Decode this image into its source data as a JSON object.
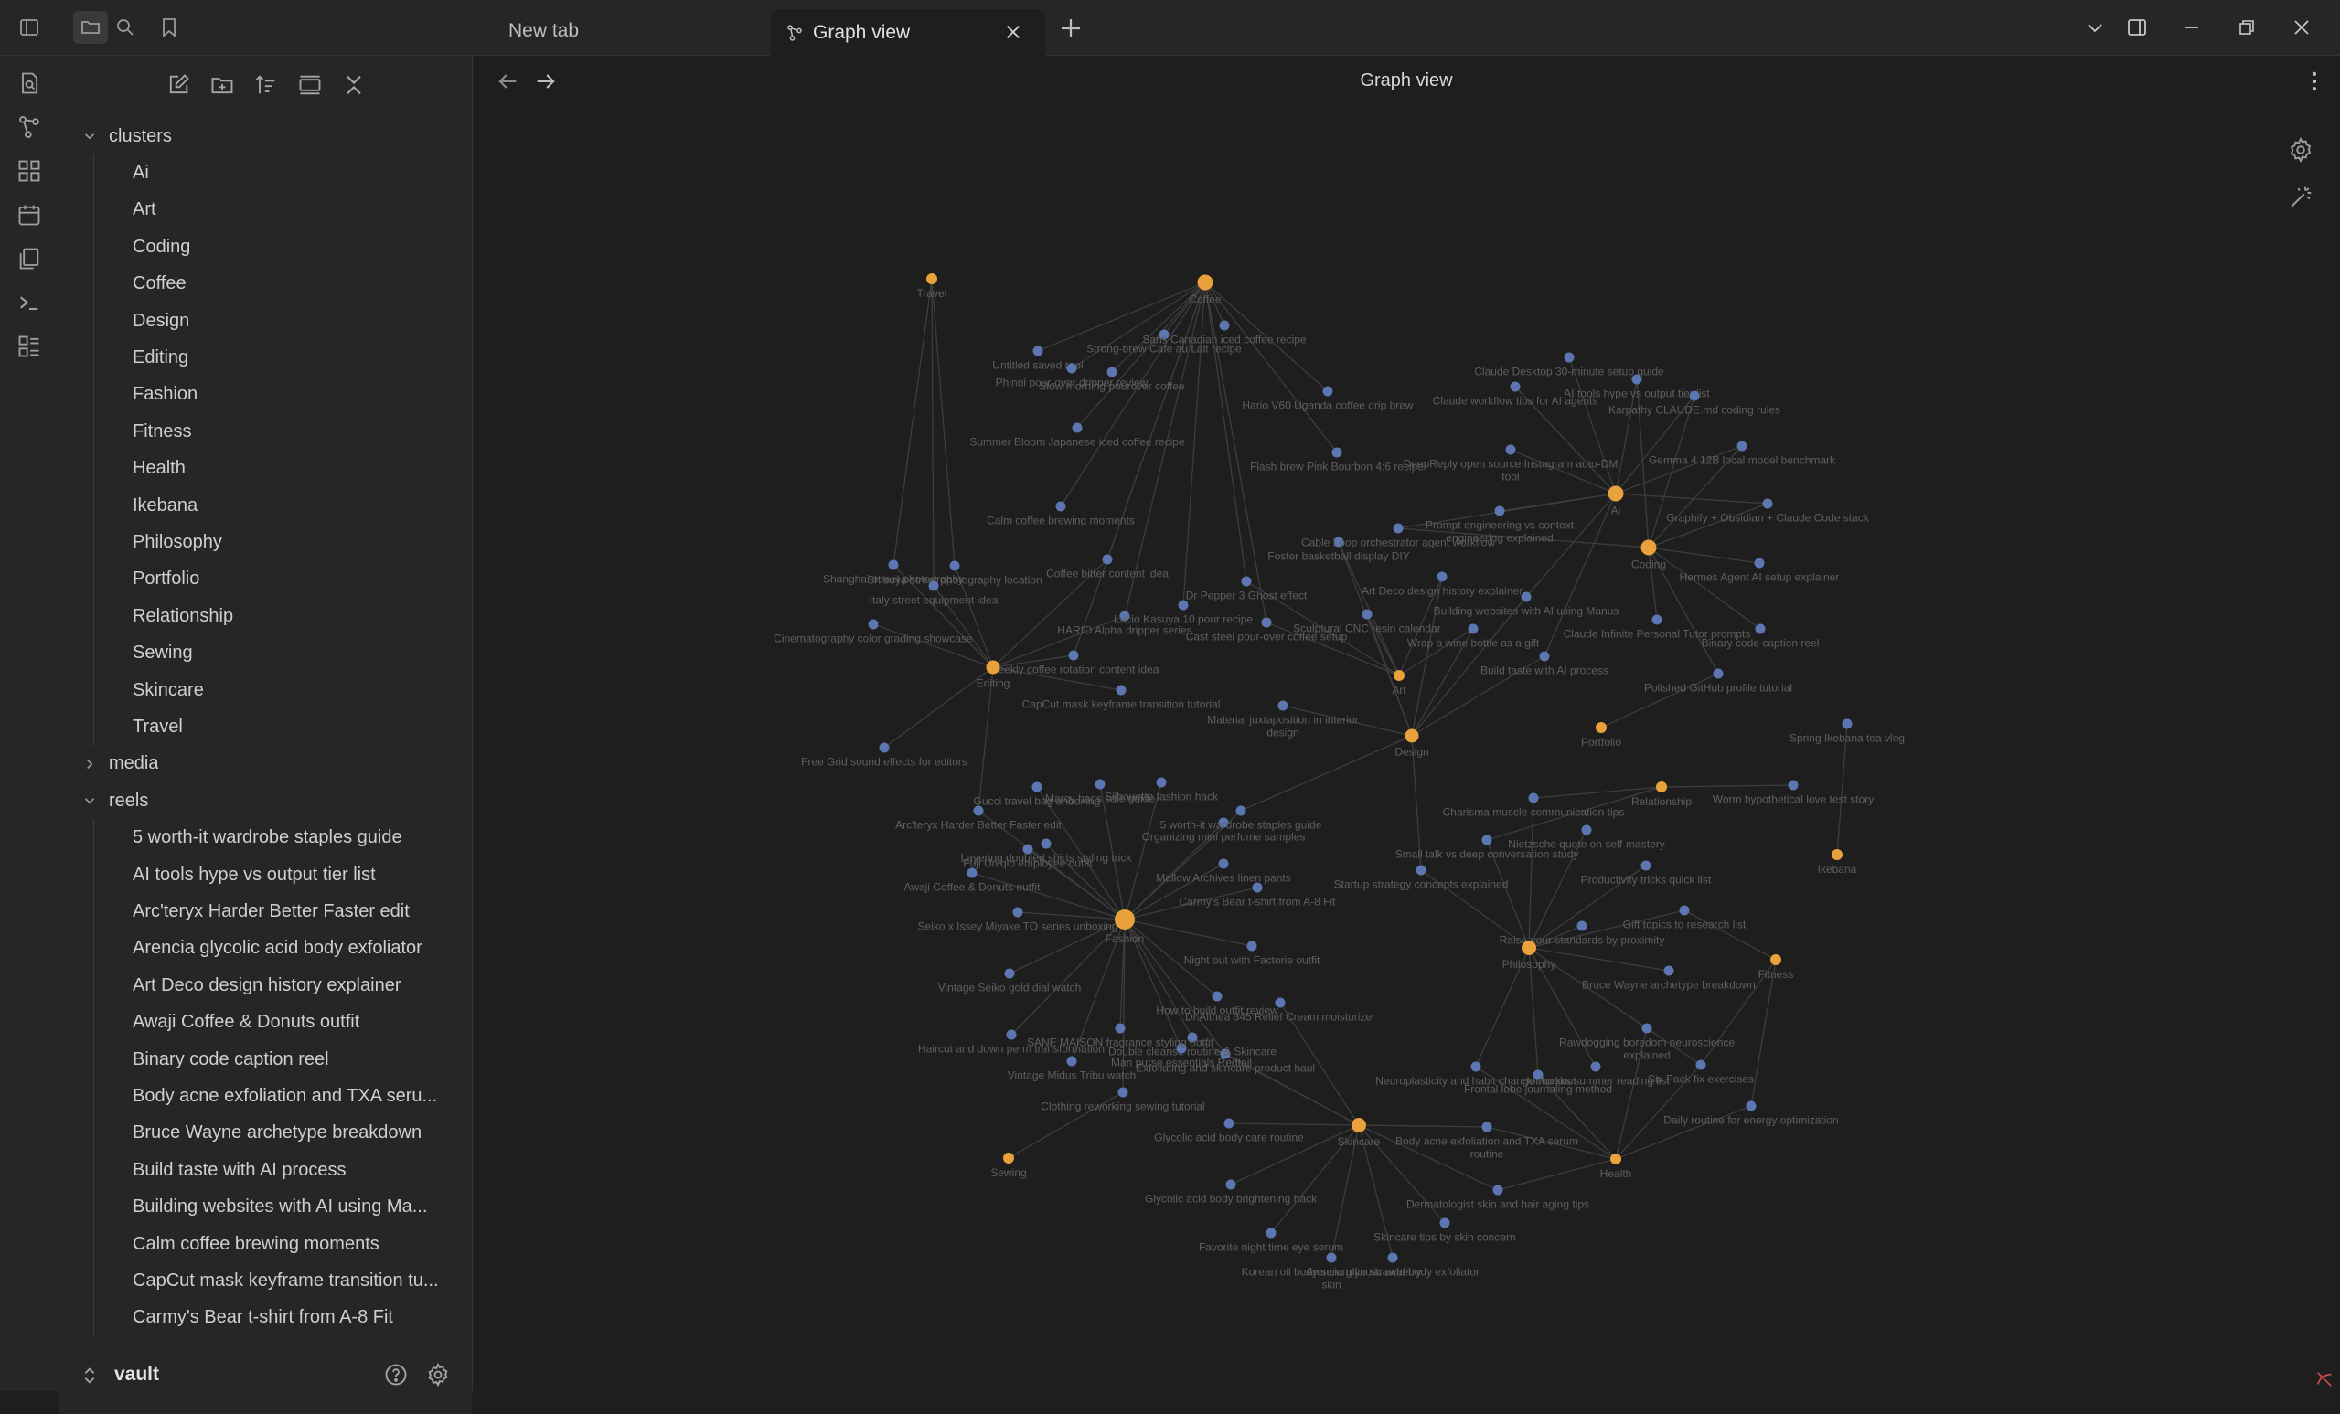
{
  "tabs": [
    {
      "label": "New tab",
      "active": false
    },
    {
      "label": "Graph view",
      "active": true
    }
  ],
  "view": {
    "title": "Graph view"
  },
  "sidebar": {
    "tree": [
      {
        "label": "clusters",
        "type": "folder",
        "expanded": true,
        "children": [
          "Ai",
          "Art",
          "Coding",
          "Coffee",
          "Design",
          "Editing",
          "Fashion",
          "Fitness",
          "Health",
          "Ikebana",
          "Philosophy",
          "Portfolio",
          "Relationship",
          "Sewing",
          "Skincare",
          "Travel"
        ]
      },
      {
        "label": "media",
        "type": "folder",
        "expanded": false,
        "children": []
      },
      {
        "label": "reels",
        "type": "folder",
        "expanded": true,
        "children": [
          "5 worth-it wardrobe staples guide",
          "AI tools hype vs output tier list",
          "Arc'teryx Harder Better Faster edit",
          "Arencia glycolic acid body exfoliator",
          "Art Deco design history explainer",
          "Awaji Coffee & Donuts outfit",
          "Binary code caption reel",
          "Body acne exfoliation and TXA seru...",
          "Bruce Wayne archetype breakdown",
          "Build taste with AI process",
          "Building websites with AI using Ma...",
          "Calm coffee brewing moments",
          "CapCut mask keyframe transition tu...",
          "Carmy's Bear t-shirt from A-8 Fit"
        ]
      }
    ],
    "vault_name": "vault"
  },
  "colors": {
    "hub": "#e9a23b",
    "note": "#5b76b0",
    "edge": "#3d3d3d",
    "label": "#5f5f5f",
    "accent": "#d14b4b"
  },
  "graph": {
    "hubs": [
      {
        "id": "Coffee",
        "label": "Coffee"
      },
      {
        "id": "Travel",
        "label": "Travel"
      },
      {
        "id": "Editing",
        "label": "Editing"
      },
      {
        "id": "Ai",
        "label": "Ai"
      },
      {
        "id": "Coding",
        "label": "Coding"
      },
      {
        "id": "Art",
        "label": "Art"
      },
      {
        "id": "Design",
        "label": "Design"
      },
      {
        "id": "Portfolio",
        "label": "Portfolio"
      },
      {
        "id": "Fashion",
        "label": "Fashion"
      },
      {
        "id": "Philosophy",
        "label": "Philosophy"
      },
      {
        "id": "Relationship",
        "label": "Relationship"
      },
      {
        "id": "Ikebana",
        "label": "Ikebana"
      },
      {
        "id": "Fitness",
        "label": "Fitness"
      },
      {
        "id": "Sewing",
        "label": "Sewing"
      },
      {
        "id": "Skincare",
        "label": "Skincare"
      },
      {
        "id": "Health",
        "label": "Health"
      }
    ],
    "notes": [
      {
        "label": "Untitled saved reel",
        "links": [
          "Coffee"
        ]
      },
      {
        "label": "Phinoi pour-over dripper review",
        "links": [
          "Coffee"
        ]
      },
      {
        "label": "Strong-brew Cafe au Lait recipe",
        "links": [
          "Coffee"
        ]
      },
      {
        "label": "Sans Canadian iced coffee recipe",
        "links": [
          "Coffee"
        ]
      },
      {
        "label": "Slow morning pourover coffee",
        "links": [
          "Coffee"
        ]
      },
      {
        "label": "Hario V60 Uganda coffee drip brew",
        "links": [
          "Coffee"
        ]
      },
      {
        "label": "Summer Bloom Japanese iced coffee recipe",
        "links": [
          "Coffee"
        ]
      },
      {
        "label": "Flash brew Pink Bourbon 4:6 recipe",
        "links": [
          "Coffee"
        ]
      },
      {
        "label": "Calm coffee brewing moments",
        "links": [
          "Coffee"
        ]
      },
      {
        "label": "Coffee bitter content idea",
        "links": [
          "Coffee",
          "Editing"
        ]
      },
      {
        "label": "Shibuya street photography location",
        "links": [
          "Travel",
          "Editing"
        ]
      },
      {
        "label": "Shanghai street photography",
        "links": [
          "Travel",
          "Editing"
        ]
      },
      {
        "label": "Italy street equipment idea",
        "links": [
          "Travel",
          "Editing"
        ]
      },
      {
        "label": "Cinematography color grading showcase",
        "links": [
          "Editing"
        ]
      },
      {
        "label": "HARIO Alpha dripper series",
        "links": [
          "Coffee",
          "Editing"
        ]
      },
      {
        "label": "Weekly coffee rotation content idea",
        "links": [
          "Coffee",
          "Editing"
        ]
      },
      {
        "label": "Lucio Kasuya 10 pour recipe",
        "links": [
          "Coffee"
        ]
      },
      {
        "label": "Cast steel pour-over coffee setup",
        "links": [
          "Coffee",
          "Art"
        ]
      },
      {
        "label": "Dr Pepper 3 Ghost effect",
        "links": [
          "Coffee",
          "Art"
        ]
      },
      {
        "label": "Free Grid sound effects for editors",
        "links": [
          "Editing"
        ]
      },
      {
        "label": "CapCut mask keyframe transition tutorial",
        "links": [
          "Editing"
        ]
      },
      {
        "label": "Material juxtaposition in interior design",
        "links": [
          "Design"
        ]
      },
      {
        "label": "Sculptural CNC resin calendar",
        "links": [
          "Art",
          "Design"
        ]
      },
      {
        "label": "Foster basketball display DIY",
        "links": [
          "Art",
          "Design"
        ]
      },
      {
        "label": "Art Deco design history explainer",
        "links": [
          "Art",
          "Design"
        ]
      },
      {
        "label": "Building websites with AI using Manus",
        "links": [
          "Design",
          "Ai"
        ]
      },
      {
        "label": "Wrap a wine bottle as a gift",
        "links": [
          "Art",
          "Design"
        ]
      },
      {
        "label": "Build taste with AI process",
        "links": [
          "Design",
          "Ai"
        ]
      },
      {
        "label": "Cable Loop orchestrator agent workflow",
        "links": [
          "Ai",
          "Coding"
        ]
      },
      {
        "label": "Claude Desktop 30-minute setup guide",
        "links": [
          "Ai"
        ]
      },
      {
        "label": "Claude workflow tips for AI agents",
        "links": [
          "Ai"
        ]
      },
      {
        "label": "AI tools hype vs output tier list",
        "links": [
          "Ai",
          "Coding"
        ]
      },
      {
        "label": "Karpathy CLAUDE.md coding rules",
        "links": [
          "Ai",
          "Coding"
        ]
      },
      {
        "label": "DeepReply open source Instagram auto-DM tool",
        "links": [
          "Ai"
        ]
      },
      {
        "label": "Gemma 4 12B local model benchmark",
        "links": [
          "Ai",
          "Coding"
        ]
      },
      {
        "label": "Prompt engineering vs context engineering explained",
        "links": [
          "Ai"
        ]
      },
      {
        "label": "Graphify + Obsidian + Claude Code stack",
        "links": [
          "Ai",
          "Coding"
        ]
      },
      {
        "label": "Hermes Agent AI setup explainer",
        "links": [
          "Coding"
        ]
      },
      {
        "label": "Claude Infinite Personal Tutor prompts",
        "links": [
          "Coding"
        ]
      },
      {
        "label": "Binary code caption reel",
        "links": [
          "Coding"
        ]
      },
      {
        "label": "Polished GitHub profile tutorial",
        "links": [
          "Coding",
          "Portfolio"
        ]
      },
      {
        "label": "Spring Ikebana tea vlog",
        "links": [
          "Ikebana"
        ]
      },
      {
        "label": "Worm hypothetical love test story",
        "links": [
          "Relationship"
        ]
      },
      {
        "label": "Charisma muscle communication tips",
        "links": [
          "Philosophy",
          "Relationship"
        ]
      },
      {
        "label": "Nietzsche quote on self-mastery",
        "links": [
          "Philosophy"
        ]
      },
      {
        "label": "Small talk vs deep conversation study",
        "links": [
          "Philosophy",
          "Relationship"
        ]
      },
      {
        "label": "Productivity tricks quick list",
        "links": [
          "Philosophy"
        ]
      },
      {
        "label": "Startup strategy concepts explained",
        "links": [
          "Philosophy",
          "Design"
        ]
      },
      {
        "label": "Raise your standards by proximity",
        "links": [
          "Philosophy"
        ]
      },
      {
        "label": "Gift topics to research list",
        "links": [
          "Philosophy",
          "Fitness"
        ]
      },
      {
        "label": "Bruce Wayne archetype breakdown",
        "links": [
          "Philosophy"
        ]
      },
      {
        "label": "Rawdogging boredom neuroscience explained",
        "links": [
          "Philosophy",
          "Health"
        ]
      },
      {
        "label": "Six Pack fix exercises",
        "links": [
          "Philosophy",
          "Fitness",
          "Health"
        ]
      },
      {
        "label": "Hot books summer reading list",
        "links": [
          "Philosophy"
        ]
      },
      {
        "label": "Neuroplasticity and habit change workout",
        "links": [
          "Philosophy",
          "Health"
        ]
      },
      {
        "label": "Frontal lobe journaling method",
        "links": [
          "Philosophy",
          "Health"
        ]
      },
      {
        "label": "Daily routine for energy optimization",
        "links": [
          "Health",
          "Fitness"
        ]
      },
      {
        "label": "Body acne exfoliation and TXA serum routine",
        "links": [
          "Skincare",
          "Health"
        ]
      },
      {
        "label": "Dermatologist skin and hair aging tips",
        "links": [
          "Skincare",
          "Health"
        ]
      },
      {
        "label": "Skincare tips by skin concern",
        "links": [
          "Skincare"
        ]
      },
      {
        "label": "Arencia glycolic acid body exfoliator",
        "links": [
          "Skincare"
        ]
      },
      {
        "label": "Korean oil body serum for strawberry skin",
        "links": [
          "Skincare"
        ]
      },
      {
        "label": "Favorite night time eye serum",
        "links": [
          "Skincare"
        ]
      },
      {
        "label": "Glycolic acid body brightening hack",
        "links": [
          "Skincare"
        ]
      },
      {
        "label": "Glycolic acid body care routine",
        "links": [
          "Skincare"
        ]
      },
      {
        "label": "Dr.Althea 345 Relief Cream moisturizer",
        "links": [
          "Skincare"
        ]
      },
      {
        "label": "Exfoliating and skincare product haul",
        "links": [
          "Skincare",
          "Fashion"
        ]
      },
      {
        "label": "Double cleanse routine & Skincare",
        "links": [
          "Skincare",
          "Fashion"
        ]
      },
      {
        "label": "Clothing reworking sewing tutorial",
        "links": [
          "Fashion",
          "Sewing"
        ]
      },
      {
        "label": "Man purse essentials Redtail",
        "links": [
          "Fashion"
        ]
      },
      {
        "label": "SANE MAISON fragrance styling outfit",
        "links": [
          "Fashion"
        ]
      },
      {
        "label": "How to build outfit review",
        "links": [
          "Fashion"
        ]
      },
      {
        "label": "Night out with Factorie outfit",
        "links": [
          "Fashion"
        ]
      },
      {
        "label": "Vintage Midus Tribu watch",
        "links": [
          "Fashion"
        ]
      },
      {
        "label": "Haircut and down perm transformation",
        "links": [
          "Fashion"
        ]
      },
      {
        "label": "Vintage Seiko gold dial watch",
        "links": [
          "Fashion"
        ]
      },
      {
        "label": "Seiko x Issey Miyake TO series unboxing",
        "links": [
          "Fashion"
        ]
      },
      {
        "label": "Layering doubled shirts styling trick",
        "links": [
          "Fashion"
        ]
      },
      {
        "label": "Carmy's Bear t-shirt from A-8 Fit",
        "links": [
          "Fashion"
        ]
      },
      {
        "label": "Mallow Archives linen pants",
        "links": [
          "Fashion"
        ]
      },
      {
        "label": "Organizing mini perfume samples",
        "links": [
          "Fashion"
        ]
      },
      {
        "label": "Awaji Coffee & Donuts outfit",
        "links": [
          "Fashion"
        ]
      },
      {
        "label": "Fuji Uniqlo employee outfit",
        "links": [
          "Fashion"
        ]
      },
      {
        "label": "Arc'teryx Harder Better Faster edit",
        "links": [
          "Fashion",
          "Editing"
        ]
      },
      {
        "label": "Gucci travel bag unboxing",
        "links": [
          "Fashion"
        ]
      },
      {
        "label": "Marcy bags sale guide",
        "links": [
          "Fashion"
        ]
      },
      {
        "label": "Silhouette fashion hack",
        "links": [
          "Fashion"
        ]
      },
      {
        "label": "5 worth-it wardrobe staples guide",
        "links": [
          "Fashion",
          "Design"
        ]
      }
    ]
  }
}
